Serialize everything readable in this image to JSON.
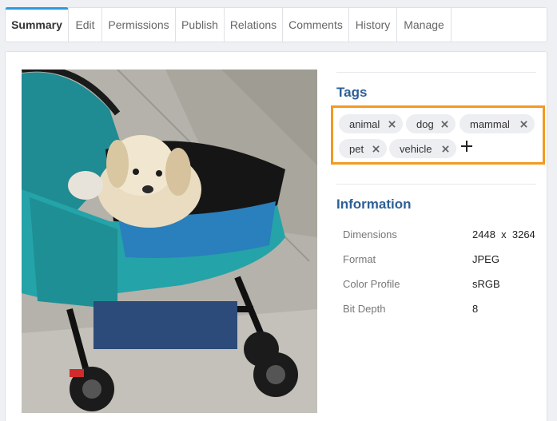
{
  "tabs": [
    {
      "label": "Summary",
      "active": true
    },
    {
      "label": "Edit"
    },
    {
      "label": "Permissions"
    },
    {
      "label": "Publish"
    },
    {
      "label": "Relations"
    },
    {
      "label": "Comments"
    },
    {
      "label": "History"
    },
    {
      "label": "Manage"
    }
  ],
  "colors": {
    "accent": "#2b9be0",
    "section_title": "#2d5f96",
    "highlight_border": "#f29a22",
    "tag_bg": "#eceef1"
  },
  "tags": {
    "title": "Tags",
    "items": [
      "animal",
      "dog",
      "mammal",
      "pet",
      "vehicle"
    ],
    "remove_icon": "close-icon",
    "add_icon": "plus-icon"
  },
  "information": {
    "title": "Information",
    "rows": [
      {
        "key": "Dimensions",
        "value": "2448  x  3264"
      },
      {
        "key": "Format",
        "value": "JPEG"
      },
      {
        "key": "Color Profile",
        "value": "sRGB"
      },
      {
        "key": "Bit Depth",
        "value": "8"
      }
    ]
  }
}
